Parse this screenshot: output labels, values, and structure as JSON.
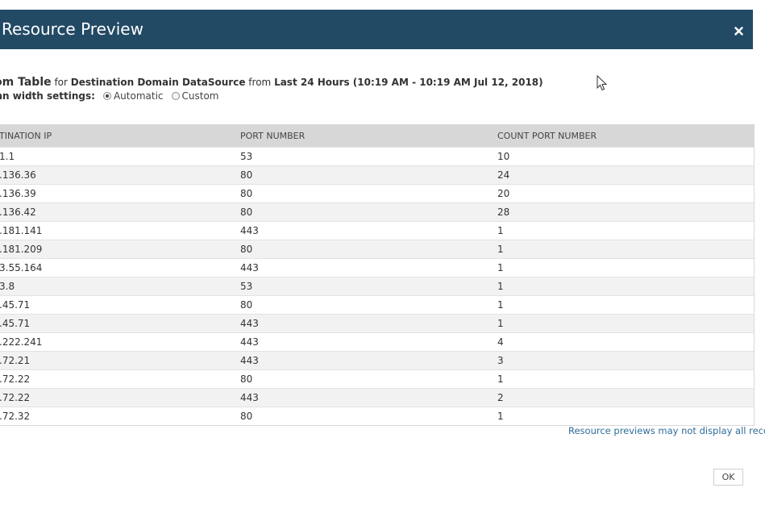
{
  "dialog": {
    "title": "Resource Preview",
    "close_glyph": "×",
    "header_color": "#234a65"
  },
  "summary": {
    "table_name": "stom Table",
    "for_word": "for",
    "datasource": "Destination Domain DataSource",
    "from_word": "from",
    "range": "Last 24 Hours (10:19 AM - 10:19 AM Jul 12, 2018)"
  },
  "column_width": {
    "label": "umn width settings:",
    "options": [
      {
        "label": "Automatic",
        "checked": true
      },
      {
        "label": "Custom",
        "checked": false
      }
    ]
  },
  "table": {
    "headers": [
      "TINATION IP",
      "PORT NUMBER",
      "COUNT PORT NUMBER"
    ],
    "rows": [
      [
        "1.1",
        "53",
        "10"
      ],
      [
        ".136.36",
        "80",
        "24"
      ],
      [
        ".136.39",
        "80",
        "20"
      ],
      [
        ".136.42",
        "80",
        "28"
      ],
      [
        ".181.141",
        "443",
        "1"
      ],
      [
        ".181.209",
        "80",
        "1"
      ],
      [
        "3.55.164",
        "443",
        "1"
      ],
      [
        "3.8",
        "53",
        "1"
      ],
      [
        ".45.71",
        "80",
        "1"
      ],
      [
        ".45.71",
        "443",
        "1"
      ],
      [
        ".222.241",
        "443",
        "4"
      ],
      [
        ".72.21",
        "443",
        "3"
      ],
      [
        ".72.22",
        "80",
        "1"
      ],
      [
        ".72.22",
        "443",
        "2"
      ],
      [
        ".72.32",
        "80",
        "1"
      ]
    ]
  },
  "footer": {
    "note": "Resource previews may not display all records.",
    "ok_label": "OK"
  },
  "icons": {
    "close": "close-icon",
    "cursor": "mouse-pointer-icon"
  }
}
